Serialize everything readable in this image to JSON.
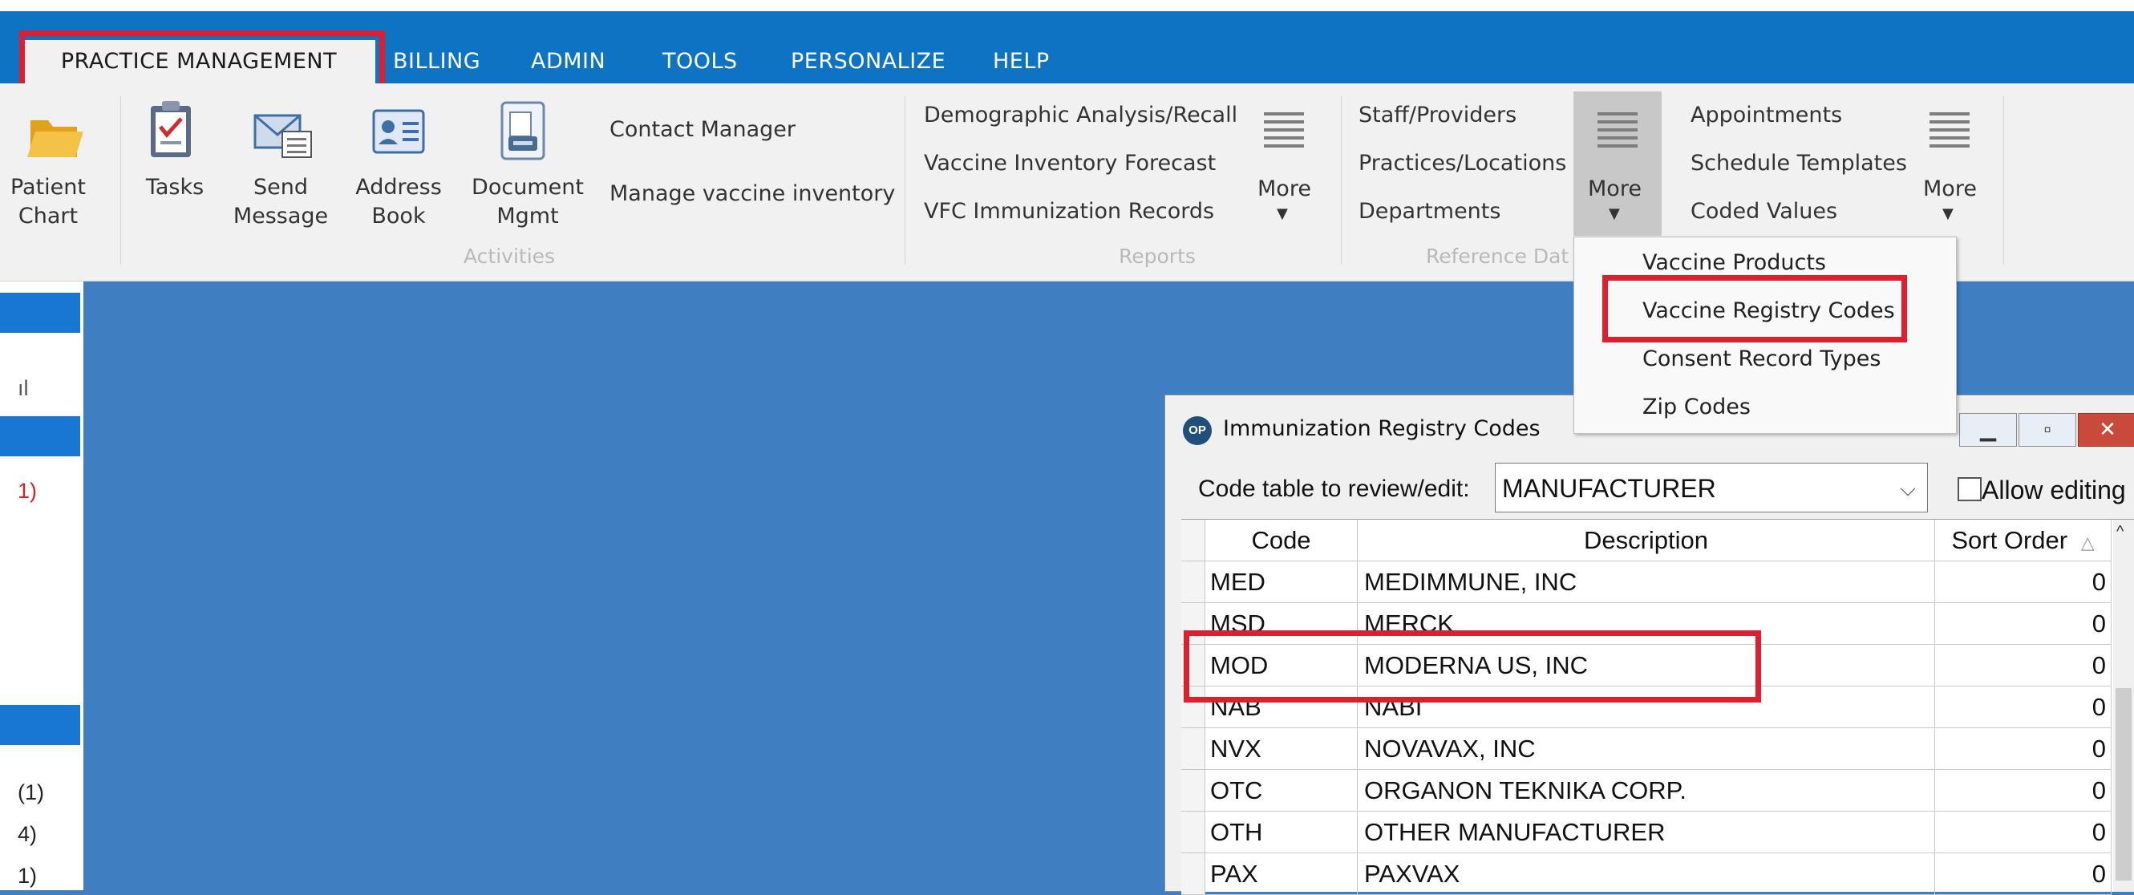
{
  "menu": {
    "tabs": [
      "PRACTICE MANAGEMENT",
      "BILLING",
      "ADMIN",
      "TOOLS",
      "PERSONALIZE",
      "HELP"
    ]
  },
  "ribbon": {
    "patient_chart": [
      "Patient",
      "Chart"
    ],
    "tasks": "Tasks",
    "send_message": [
      "Send",
      "Message"
    ],
    "address_book": [
      "Address",
      "Book"
    ],
    "document_mgmt": [
      "Document",
      "Mgmt"
    ],
    "contact_manager": "Contact Manager",
    "manage_vaccine_inventory": "Manage vaccine inventory",
    "activities_label": "Activities",
    "reports": [
      "Demographic Analysis/Recall",
      "Vaccine Inventory Forecast",
      "VFC Immunization Records"
    ],
    "reports_more": "More",
    "reports_label": "Reports",
    "reference": [
      "Staff/Providers",
      "Practices/Locations",
      "Departments"
    ],
    "reference_more": "More",
    "reference_label": "Reference Dat",
    "scheduling": [
      "Appointments",
      "Schedule Templates",
      "Coded Values"
    ],
    "scheduling_more": "More"
  },
  "dropdown": {
    "items": [
      "Vaccine Products",
      "Vaccine Registry Codes",
      "Consent Record Types",
      "Zip Codes"
    ]
  },
  "left_panel": {
    "texts": [
      "ıl",
      "1)",
      "(1)",
      "4)",
      "1)"
    ]
  },
  "window": {
    "logo": "OP",
    "title": "Immunization Registry Codes",
    "code_table_label": "Code table to review/edit:",
    "code_table_value": "MANUFACTURER",
    "allow_editing_label": "Allow editing",
    "columns": [
      "Code",
      "Description",
      "Sort Order"
    ],
    "rows": [
      {
        "code": "MED",
        "description": "MEDIMMUNE, INC",
        "sort": "0"
      },
      {
        "code": "MSD",
        "description": "MERCK",
        "sort": "0"
      },
      {
        "code": "MOD",
        "description": "MODERNA US, INC",
        "sort": "0"
      },
      {
        "code": "NAB",
        "description": "NABI",
        "sort": "0"
      },
      {
        "code": "NVX",
        "description": "NOVAVAX, INC",
        "sort": "0"
      },
      {
        "code": "OTC",
        "description": "ORGANON TEKNIKA CORP.",
        "sort": "0"
      },
      {
        "code": "OTH",
        "description": "OTHER MANUFACTURER",
        "sort": "0"
      },
      {
        "code": "PAX",
        "description": "PAXVAX",
        "sort": "0"
      }
    ]
  },
  "colors": {
    "top_bar": "#0f73c4",
    "desktop": "#3f7fc1",
    "highlight": "#dd1f2f",
    "ribbon": "#f1f1f1"
  }
}
